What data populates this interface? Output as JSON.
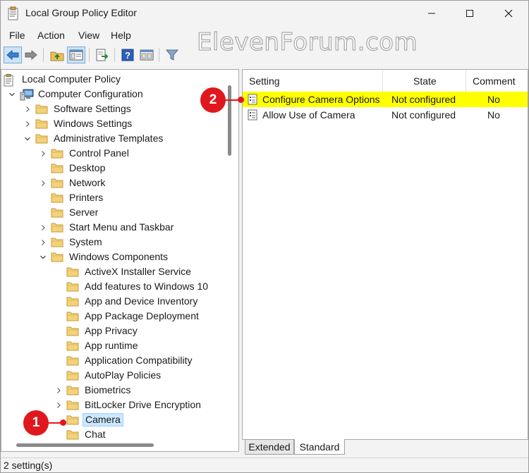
{
  "window": {
    "title": "Local Group Policy Editor",
    "watermark": "ElevenForum.com"
  },
  "menu": [
    "File",
    "Action",
    "View",
    "Help"
  ],
  "toolbar": {
    "buttons": [
      "back-icon",
      "forward-icon",
      "up-folder-icon",
      "show-hide-tree-icon",
      "export-list-icon",
      "help-icon",
      "properties-icon",
      "filter-icon"
    ]
  },
  "tree": {
    "root": "Local Computer Policy",
    "computer_configuration": "Computer Configuration",
    "software_settings": "Software Settings",
    "windows_settings": "Windows Settings",
    "administrative_templates": "Administrative Templates",
    "control_panel": "Control Panel",
    "desktop": "Desktop",
    "network": "Network",
    "printers": "Printers",
    "server": "Server",
    "start_menu": "Start Menu and Taskbar",
    "system": "System",
    "windows_components": "Windows Components",
    "components": [
      "ActiveX Installer Service",
      "Add features to Windows 10",
      "App and Device Inventory",
      "App Package Deployment",
      "App Privacy",
      "App runtime",
      "Application Compatibility",
      "AutoPlay Policies",
      "Biometrics",
      "BitLocker Drive Encryption",
      "Camera",
      "Chat"
    ]
  },
  "list": {
    "columns": {
      "setting": "Setting",
      "state": "State",
      "comment": "Comment"
    },
    "rows": [
      {
        "setting": "Configure Camera Options",
        "state": "Not configured",
        "comment": "No"
      },
      {
        "setting": "Allow Use of Camera",
        "state": "Not configured",
        "comment": "No"
      }
    ]
  },
  "tabs": {
    "extended": "Extended",
    "standard": "Standard"
  },
  "status": "2 setting(s)",
  "callouts": {
    "one": "1",
    "two": "2"
  },
  "colors": {
    "highlight": "#ffff00",
    "callout": "#e1171e",
    "selection": "#cce8ff"
  }
}
